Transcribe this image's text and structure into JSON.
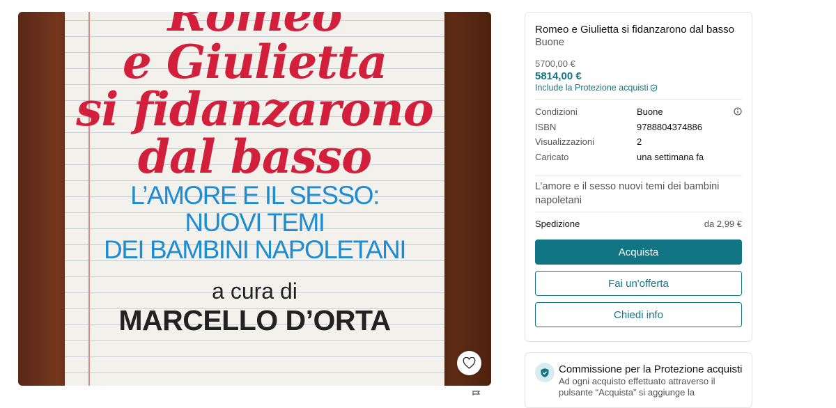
{
  "photo": {
    "cover_title": "Romeo\ne Giulietta\nsi fidanzarono\ndal basso",
    "cover_subtitle": "L’AMORE E IL SESSO:\nNUOVI TEMI\nDEI BAMBINI NAPOLETANI",
    "cover_curator": "a cura di",
    "cover_author": "MARCELLO D’ORTA",
    "favorite_icon": "heart-icon"
  },
  "item": {
    "title": "Romeo e Giulietta si fidanzarono dal basso",
    "condition_subtitle": "Buone",
    "old_price": "5700,00 €",
    "price": "5814,00 €",
    "protection_link": "Include la Protezione acquisti"
  },
  "details": [
    {
      "label": "Condizioni",
      "value": "Buone"
    },
    {
      "label": "ISBN",
      "value": "9788804374886"
    },
    {
      "label": "Visualizzazioni",
      "value": "2"
    },
    {
      "label": "Caricato",
      "value": "una settimana fa"
    }
  ],
  "description": "L’amore e il sesso nuovi temi dei bambini napoletani",
  "shipping": {
    "label": "Spedizione",
    "value": "da 2,99 €"
  },
  "buttons": {
    "buy": "Acquista",
    "offer": "Fai un'offerta",
    "ask": "Chiedi info"
  },
  "protection_card": {
    "title": "Commissione per la Protezione acquisti",
    "text": "Ad ogni acquisto effettuato attraverso il pulsante “Acquista” si aggiunge la"
  },
  "colors": {
    "accent": "#127583",
    "cover_red": "#d21f3c",
    "cover_blue": "#1f8bd1"
  }
}
